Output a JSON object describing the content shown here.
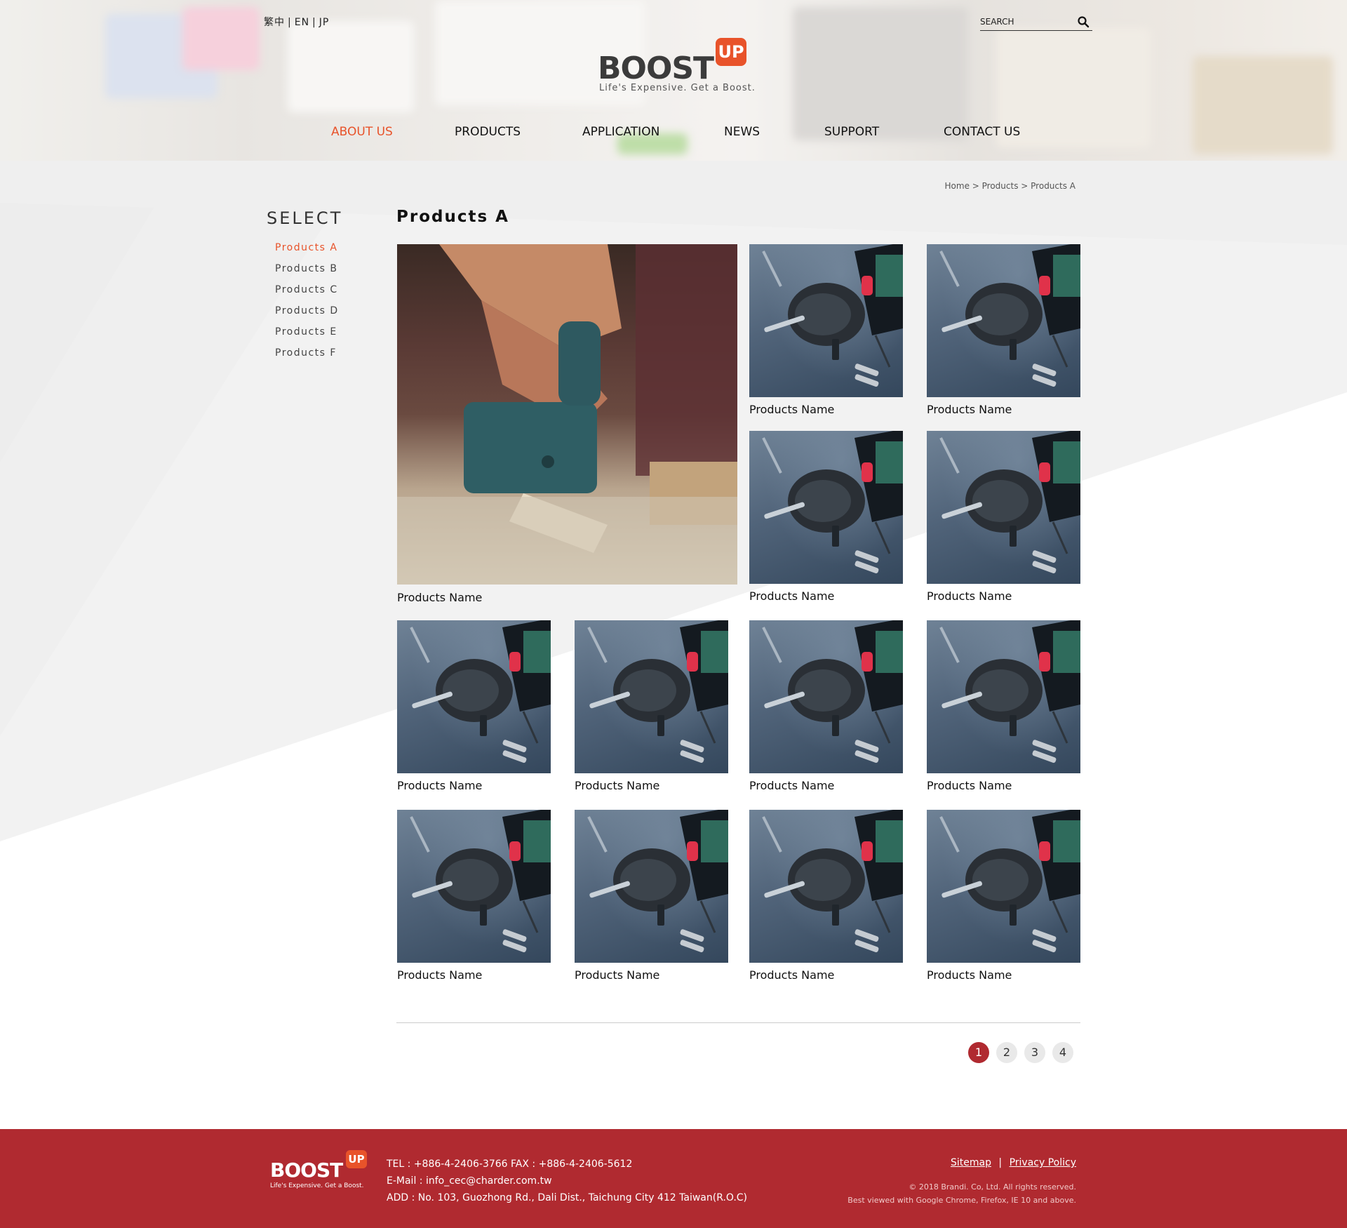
{
  "header": {
    "languages": [
      "繁中",
      "EN",
      "JP"
    ],
    "search_placeholder": "SEARCH",
    "logo": {
      "word": "BOOST",
      "badge": "UP",
      "tagline": "Life's Expensive. Get a Boost."
    },
    "nav": [
      "ABOUT US",
      "PRODUCTS",
      "APPLICATION",
      "NEWS",
      "SUPPORT",
      "CONTACT US"
    ],
    "active_nav": "ABOUT US"
  },
  "breadcrumb": [
    "Home",
    "Products",
    "Products A"
  ],
  "sidebar": {
    "title": "SELECT",
    "items": [
      "Products A",
      "Products B",
      "Products C",
      "Products D",
      "Products E",
      "Products F"
    ],
    "active": "Products A"
  },
  "main": {
    "title": "Products A",
    "products": [
      "Products Name",
      "Products Name",
      "Products Name",
      "Products Name",
      "Products Name",
      "Products Name",
      "Products Name",
      "Products Name",
      "Products Name",
      "Products Name",
      "Products Name",
      "Products Name",
      "Products Name"
    ]
  },
  "pagination": {
    "pages": [
      "1",
      "2",
      "3",
      "4"
    ],
    "current": "1"
  },
  "footer": {
    "logo": {
      "word": "BOOST",
      "badge": "UP",
      "tagline": "Life's Expensive. Get a Boost."
    },
    "tel": "TEL : +886-4-2406-3766   FAX : +886-4-2406-5612",
    "email": "E-Mail : info_cec@charder.com.tw",
    "address": "ADD : No. 103, Guozhong Rd., Dali Dist., Taichung City 412 Taiwan(R.O.C)",
    "links": [
      "Sitemap",
      "Privacy Policy"
    ],
    "copyright": "© 2018 Brandi. Co, Ltd. All rights reserved.",
    "browsers": "Best viewed with Google Chrome, Firefox, IE 10 and above."
  },
  "colors": {
    "accent": "#e8532a",
    "footer_bg": "#b02a30",
    "pager_active": "#b02a30"
  }
}
